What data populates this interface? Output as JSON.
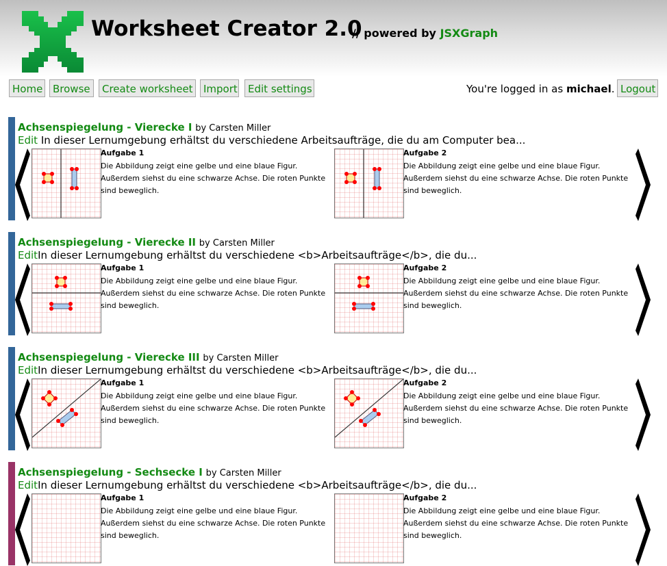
{
  "header": {
    "title": "Worksheet Creator 2.0",
    "powered_prefix": "// powered by",
    "powered_link": "JSXGraph",
    "logo_icon": "jsxgraph-x-logo",
    "brand_color": "#138a13"
  },
  "nav": {
    "home": "Home",
    "browse": "Browse",
    "create": "Create worksheet",
    "import": "Import",
    "settings": "Edit settings",
    "logout": "Logout"
  },
  "login": {
    "prefix": "You're logged in as",
    "user": "michael",
    "suffix": "."
  },
  "worksheets": [
    {
      "title": "Achsenspiegelung - Vierecke I",
      "author": "by Carsten Miller",
      "edit": "Edit",
      "description": " In dieser Lernumgebung erhältst du verschiedene Arbeitsaufträge, die du am Computer bea...",
      "bar_color": "#336699",
      "tasks": [
        {
          "title": "Aufgabe 1",
          "text": "Die Abbildung zeigt eine gelbe und eine blaue Figur. Außerdem siehst du eine schwarze Achse. Die roten Punkte sind beweglich."
        },
        {
          "title": "Aufgabe 2",
          "text": "Die Abbildung zeigt eine gelbe und eine blaue Figur. Außerdem siehst du eine schwarze Achse. Die roten Punkte sind beweglich."
        }
      ]
    },
    {
      "title": "Achsenspiegelung - Vierecke II",
      "author": "by Carsten Miller",
      "edit": "Edit",
      "description": "In dieser Lernumgebung erhältst du verschiedene <b>Arbeitsaufträge</b>, die du...",
      "bar_color": "#336699",
      "tasks": [
        {
          "title": "Aufgabe 1",
          "text": "Die Abbildung zeigt eine gelbe und eine blaue Figur. Außerdem siehst du eine schwarze Achse. Die roten Punkte sind beweglich."
        },
        {
          "title": "Aufgabe 2",
          "text": "Die Abbildung zeigt eine gelbe und eine blaue Figur. Außerdem siehst du eine schwarze Achse. Die roten Punkte sind beweglich."
        }
      ]
    },
    {
      "title": "Achsenspiegelung - Vierecke III",
      "author": "by Carsten Miller",
      "edit": "Edit",
      "description": "In dieser Lernumgebung erhältst du verschiedene <b>Arbeitsaufträge</b>, die du...",
      "bar_color": "#336699",
      "tasks": [
        {
          "title": "Aufgabe 1",
          "text": "Die Abbildung zeigt eine gelbe und eine blaue Figur. Außerdem siehst du eine schwarze Achse. Die roten Punkte sind beweglich."
        },
        {
          "title": "Aufgabe 2",
          "text": "Die Abbildung zeigt eine gelbe und eine blaue Figur. Außerdem siehst du eine schwarze Achse. Die roten Punkte sind beweglich."
        }
      ]
    },
    {
      "title": "Achsenspiegelung - Sechsecke I",
      "author": "by Carsten Miller",
      "edit": "Edit",
      "description": "In dieser Lernumgebung erhältst du verschiedene <b>Arbeitsaufträge</b>, die du...",
      "bar_color": "#993366",
      "tasks": [
        {
          "title": "Aufgabe 1",
          "text": "Die Abbildung zeigt eine gelbe und eine blaue Figur. Außerdem siehst du eine schwarze Achse. Die roten Punkte sind beweglich."
        },
        {
          "title": "Aufgabe 2",
          "text": "Die Abbildung zeigt eine gelbe und eine blaue Figur. Außerdem siehst du eine schwarze Achse. Die roten Punkte sind beweglich."
        }
      ]
    }
  ]
}
